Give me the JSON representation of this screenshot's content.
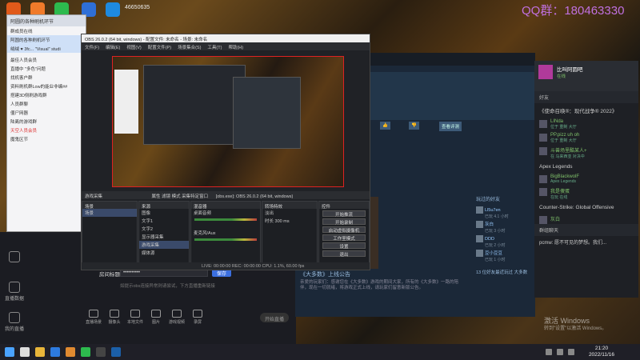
{
  "desktop": {
    "icons": [
      {
        "name": "Computer",
        "color": "#e05a1a"
      },
      {
        "name": "QQ",
        "color": "#f07a2a"
      },
      {
        "name": "WeChat",
        "color": "#2dba4e"
      },
      {
        "name": "Douyin",
        "color": "#2f6fd6"
      },
      {
        "name": "Kuaishou",
        "color": "#1e8ae0"
      }
    ],
    "counter": "46650635",
    "qq_watermark": "QQ群：180463330"
  },
  "chat_window": {
    "title": "阿圆的各种刷机环节",
    "rows": [
      {
        "text": "群成员在线",
        "style": ""
      },
      {
        "text": "阿圆的各种刷机环节",
        "style": "sel"
      },
      {
        "text": "  绒绒 ♥ 3fc... \"Visual\" studi",
        "style": "sel"
      },
      {
        "text": "",
        "style": ""
      },
      {
        "text": "最佳人员会员",
        "style": ""
      },
      {
        "text": "直播中 \"多色\"问题",
        "style": ""
      },
      {
        "text": "找机客户群",
        "style": ""
      },
      {
        "text": "资料刷机群Low的能业非编##",
        "style": ""
      },
      {
        "text": "搭建3D侧刷游戏群",
        "style": ""
      },
      {
        "text": "人员群聊",
        "style": ""
      },
      {
        "text": "僵尸网器",
        "style": ""
      },
      {
        "text": "陆离的游戏群",
        "style": ""
      },
      {
        "text": "天空人员会员",
        "style": "hl"
      },
      {
        "text": "魔鬼区节",
        "style": ""
      }
    ]
  },
  "obs": {
    "title": "OBS 26.0.2 (64 bit, windows) - 配置文件: 未命名 - 场景: 未命名",
    "menu": [
      "文件(F)",
      "编辑(E)",
      "视图(V)",
      "配置文件(P)",
      "场景集合(S)",
      "工具(T)",
      "帮助(H)"
    ],
    "source_bar": "游戏采集",
    "source_bar_props": "属性   滤镜    模式   采集特定窗口",
    "source_bar_window": "[obs.exe]: OBS 26.0.2 (64 bit, windows)",
    "docks": {
      "scenes": {
        "header": "场景",
        "items": [
          "场景"
        ]
      },
      "sources": {
        "header": "来源",
        "items": [
          "图像",
          "文字1",
          "文字2",
          "显示器采集",
          "游戏采集",
          "媒体源"
        ]
      },
      "mixer": {
        "header": "混音器",
        "channels": [
          "桌面音频",
          "麦克风/Aux"
        ]
      },
      "transitions": {
        "header": "转场特效",
        "mode": "淡出",
        "duration_label": "时长",
        "duration": "300 ms"
      },
      "controls": {
        "header": "控件",
        "buttons": [
          "开始推流",
          "开始录制",
          "启动虚拟摄像机",
          "工作室模式",
          "设置",
          "退出"
        ]
      }
    },
    "status": "LIVE: 00:00:00    REC: 00:00:00    CPU: 1.1%, 60.00 fps"
  },
  "stream_panel": {
    "side_items": [
      "",
      "直播数据",
      "我的直播"
    ],
    "room_title_label": "房间标题",
    "room_title_value": "••••••••••",
    "save_button": "保存",
    "hint": "如提示obs连接异常则请尝试，下方直播重新链接",
    "tools": [
      "直播场景",
      "摄像头",
      "本地文件",
      "图片",
      "游戏视频",
      "录屏"
    ],
    "go_live": "开始直播"
  },
  "steam": {
    "search_placeholder": "",
    "buttons": [
      "👍",
      "👎",
      "查看评测"
    ],
    "friends_header": "玩过的好友",
    "friends": [
      {
        "name": "Ll5u7en",
        "sub": "已玩 4.1 小时"
      },
      {
        "name": "灰白",
        "sub": "已玩 3 小时"
      },
      {
        "name": "DDD",
        "sub": "已玩 2 小时"
      },
      {
        "name": "豆小豆豆",
        "sub": "已玩 1 小时"
      }
    ],
    "announcement_title": "《大多数》上线公告",
    "announcement_text": "亲爱的玩家们：感谢您在《大多数》游戏的期间大家，所有的《大多数》一路的陪伴，现在一切就绪，将游戏正式上线，请玩家们留意新版公告。",
    "recent_label": "13 位好友最近玩过 大多数"
  },
  "friends_panel": {
    "profile_name": "比叫阿圆吧",
    "profile_status": "在线",
    "friends_label": "好友",
    "games": [
      {
        "title": "《使命召唤®：现代战争® 2022》",
        "players": [
          {
            "name": "LINda",
            "status": "位于 重制 大厅"
          },
          {
            "name": "PP.pizz uh oh",
            "status": "位于 重制 大厅"
          },
          {
            "name": "斗兽场里酷某人+",
            "status": "在 马来西亚 对决中"
          }
        ]
      },
      {
        "title": "Apex Legends",
        "players": [
          {
            "name": "BigBlackwolF",
            "status": "Apex Legends"
          },
          {
            "name": "我是傻蛋",
            "status": "在玩 在线"
          }
        ]
      },
      {
        "title": "Counter-Strike: Global Offensive",
        "players": [
          {
            "name": "灰白",
            "status": ""
          }
        ]
      }
    ],
    "chat_label": "群组聊天",
    "chat_line": "pcmw:   愿不可见的梦想。我们..."
  },
  "windows_watermark": {
    "line1": "激活 Windows",
    "line2": "转到\"设置\"以激活 Windows。"
  },
  "taskbar": {
    "time": "21:20",
    "date": "2022/11/16",
    "icons": [
      {
        "name": "start",
        "color": "#4aa3ff"
      },
      {
        "name": "search",
        "color": "#ddd"
      },
      {
        "name": "file-explorer",
        "color": "#e8b53a"
      },
      {
        "name": "store",
        "color": "#2d7be0"
      },
      {
        "name": "qq",
        "color": "#e08a30"
      },
      {
        "name": "wechat",
        "color": "#2dba4e"
      },
      {
        "name": "obs",
        "color": "#444"
      },
      {
        "name": "steam",
        "color": "#1b5fa8"
      }
    ]
  }
}
